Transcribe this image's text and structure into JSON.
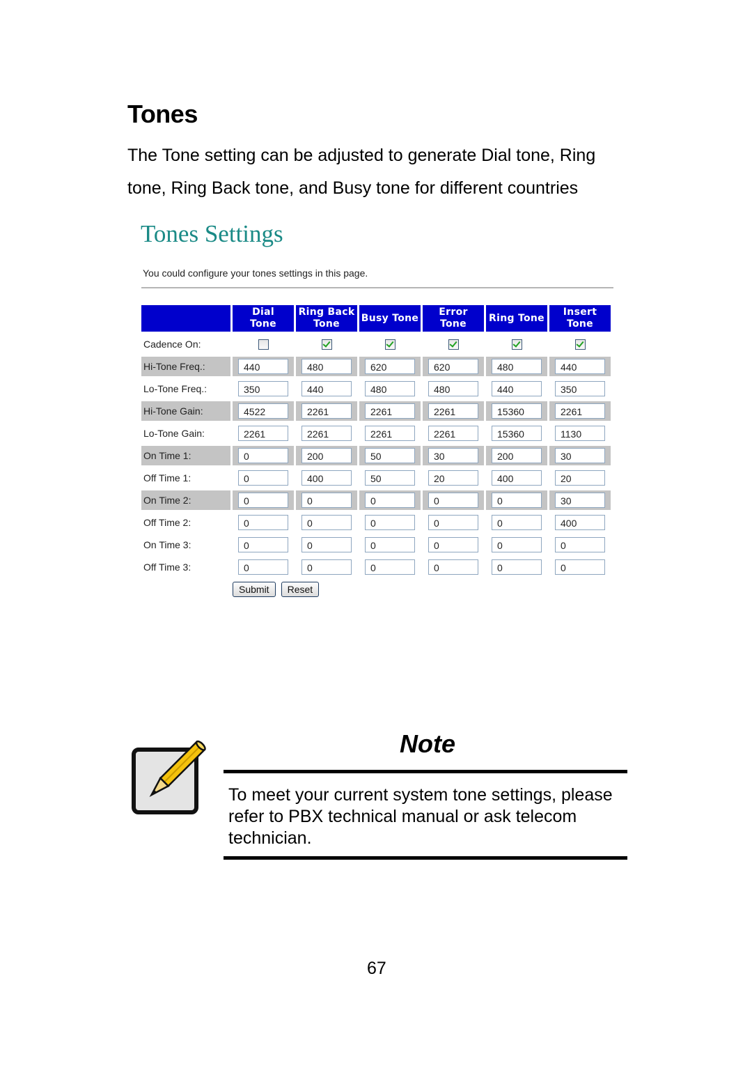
{
  "document": {
    "title": "Tones",
    "intro": "The Tone setting can be adjusted to generate Dial tone, Ring tone, Ring Back tone, and Busy tone for different countries",
    "page_number": "67"
  },
  "app": {
    "title": "Tones Settings",
    "description": "You could configure your tones settings in this page.",
    "columns": [
      {
        "line1": "Dial",
        "line2": "Tone"
      },
      {
        "line1": "Ring Back",
        "line2": "Tone"
      },
      {
        "line1": "Busy Tone",
        "line2": ""
      },
      {
        "line1": "Error Tone",
        "line2": ""
      },
      {
        "line1": "Ring Tone",
        "line2": ""
      },
      {
        "line1": "Insert Tone",
        "line2": ""
      }
    ],
    "cadence": {
      "label": "Cadence On:",
      "checked": [
        false,
        true,
        true,
        true,
        true,
        true
      ]
    },
    "rows": [
      {
        "label": "Hi-Tone Freq.:",
        "values": [
          "440",
          "480",
          "620",
          "620",
          "480",
          "440"
        ],
        "shaded": true
      },
      {
        "label": "Lo-Tone Freq.:",
        "values": [
          "350",
          "440",
          "480",
          "480",
          "440",
          "350"
        ],
        "shaded": false
      },
      {
        "label": "Hi-Tone Gain:",
        "values": [
          "4522",
          "2261",
          "2261",
          "2261",
          "15360",
          "2261"
        ],
        "shaded": true
      },
      {
        "label": "Lo-Tone Gain:",
        "values": [
          "2261",
          "2261",
          "2261",
          "2261",
          "15360",
          "1130"
        ],
        "shaded": false
      },
      {
        "label": "On Time 1:",
        "values": [
          "0",
          "200",
          "50",
          "30",
          "200",
          "30"
        ],
        "shaded": true
      },
      {
        "label": "Off Time 1:",
        "values": [
          "0",
          "400",
          "50",
          "20",
          "400",
          "20"
        ],
        "shaded": false
      },
      {
        "label": "On Time 2:",
        "values": [
          "0",
          "0",
          "0",
          "0",
          "0",
          "30"
        ],
        "shaded": true
      },
      {
        "label": "Off Time 2:",
        "values": [
          "0",
          "0",
          "0",
          "0",
          "0",
          "400"
        ],
        "shaded": false
      },
      {
        "label": "On Time 3:",
        "values": [
          "0",
          "0",
          "0",
          "0",
          "0",
          "0"
        ],
        "shaded": false
      },
      {
        "label": "Off Time 3:",
        "values": [
          "0",
          "0",
          "0",
          "0",
          "0",
          "0"
        ],
        "shaded": false
      }
    ],
    "buttons": {
      "submit": "Submit",
      "reset": "Reset"
    },
    "colors": {
      "header_bg": "#0000cc",
      "title": "#1a8a86",
      "shaded_row": "#c4c4c4"
    }
  },
  "note": {
    "title": "Note",
    "icon": "pencil-notepad-icon",
    "text": "To meet your current system tone settings, please refer to PBX technical manual or ask telecom technician."
  }
}
